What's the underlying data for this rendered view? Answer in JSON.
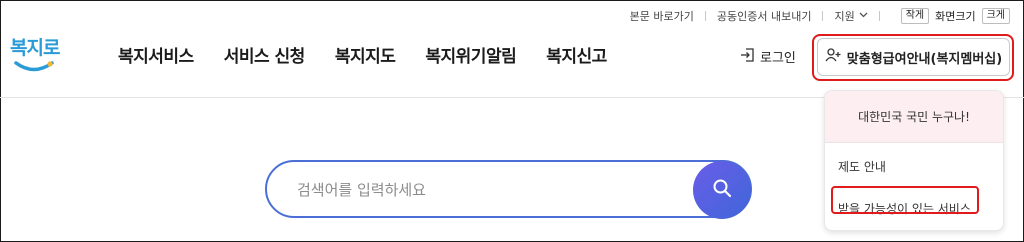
{
  "utility": {
    "skip_to_content": "본문 바로가기",
    "cert_export": "공동인증서 내보내기",
    "support": "지원",
    "font_small": "작게",
    "font_size_label": "화면크기",
    "font_large": "크게"
  },
  "logo": {
    "text": "복지로"
  },
  "nav": [
    {
      "label": "복지서비스"
    },
    {
      "label": "서비스 신청"
    },
    {
      "label": "복지지도"
    },
    {
      "label": "복지위기알림"
    },
    {
      "label": "복지신고"
    }
  ],
  "login": {
    "label": "로그인"
  },
  "membership": {
    "label": "맞춤형급여안내(복지멤버십)"
  },
  "dropdown": {
    "header": "대한민국 국민 누구나!",
    "items": [
      {
        "label": "제도 안내"
      },
      {
        "label": "받을 가능성이 있는 서비스"
      }
    ]
  },
  "search": {
    "placeholder": "검색어를 입력하세요"
  },
  "colors": {
    "highlight": "#e01b1b",
    "search_border": "#4b6fd6",
    "dropdown_header_bg": "#fdeff1",
    "logo_blue": "#2a9bd6"
  }
}
